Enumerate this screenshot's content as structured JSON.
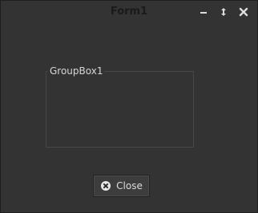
{
  "window": {
    "title": "Form1"
  },
  "titlebar_buttons": {
    "minimize": "minimize-icon",
    "maximize": "maximize-icon",
    "close": "close-icon"
  },
  "groupbox": {
    "label": "GroupBox1"
  },
  "close_button": {
    "label": "Close",
    "icon": "close-x-icon"
  },
  "colors": {
    "background": "#333333",
    "text": "#dcdcdc",
    "border": "#474747"
  }
}
